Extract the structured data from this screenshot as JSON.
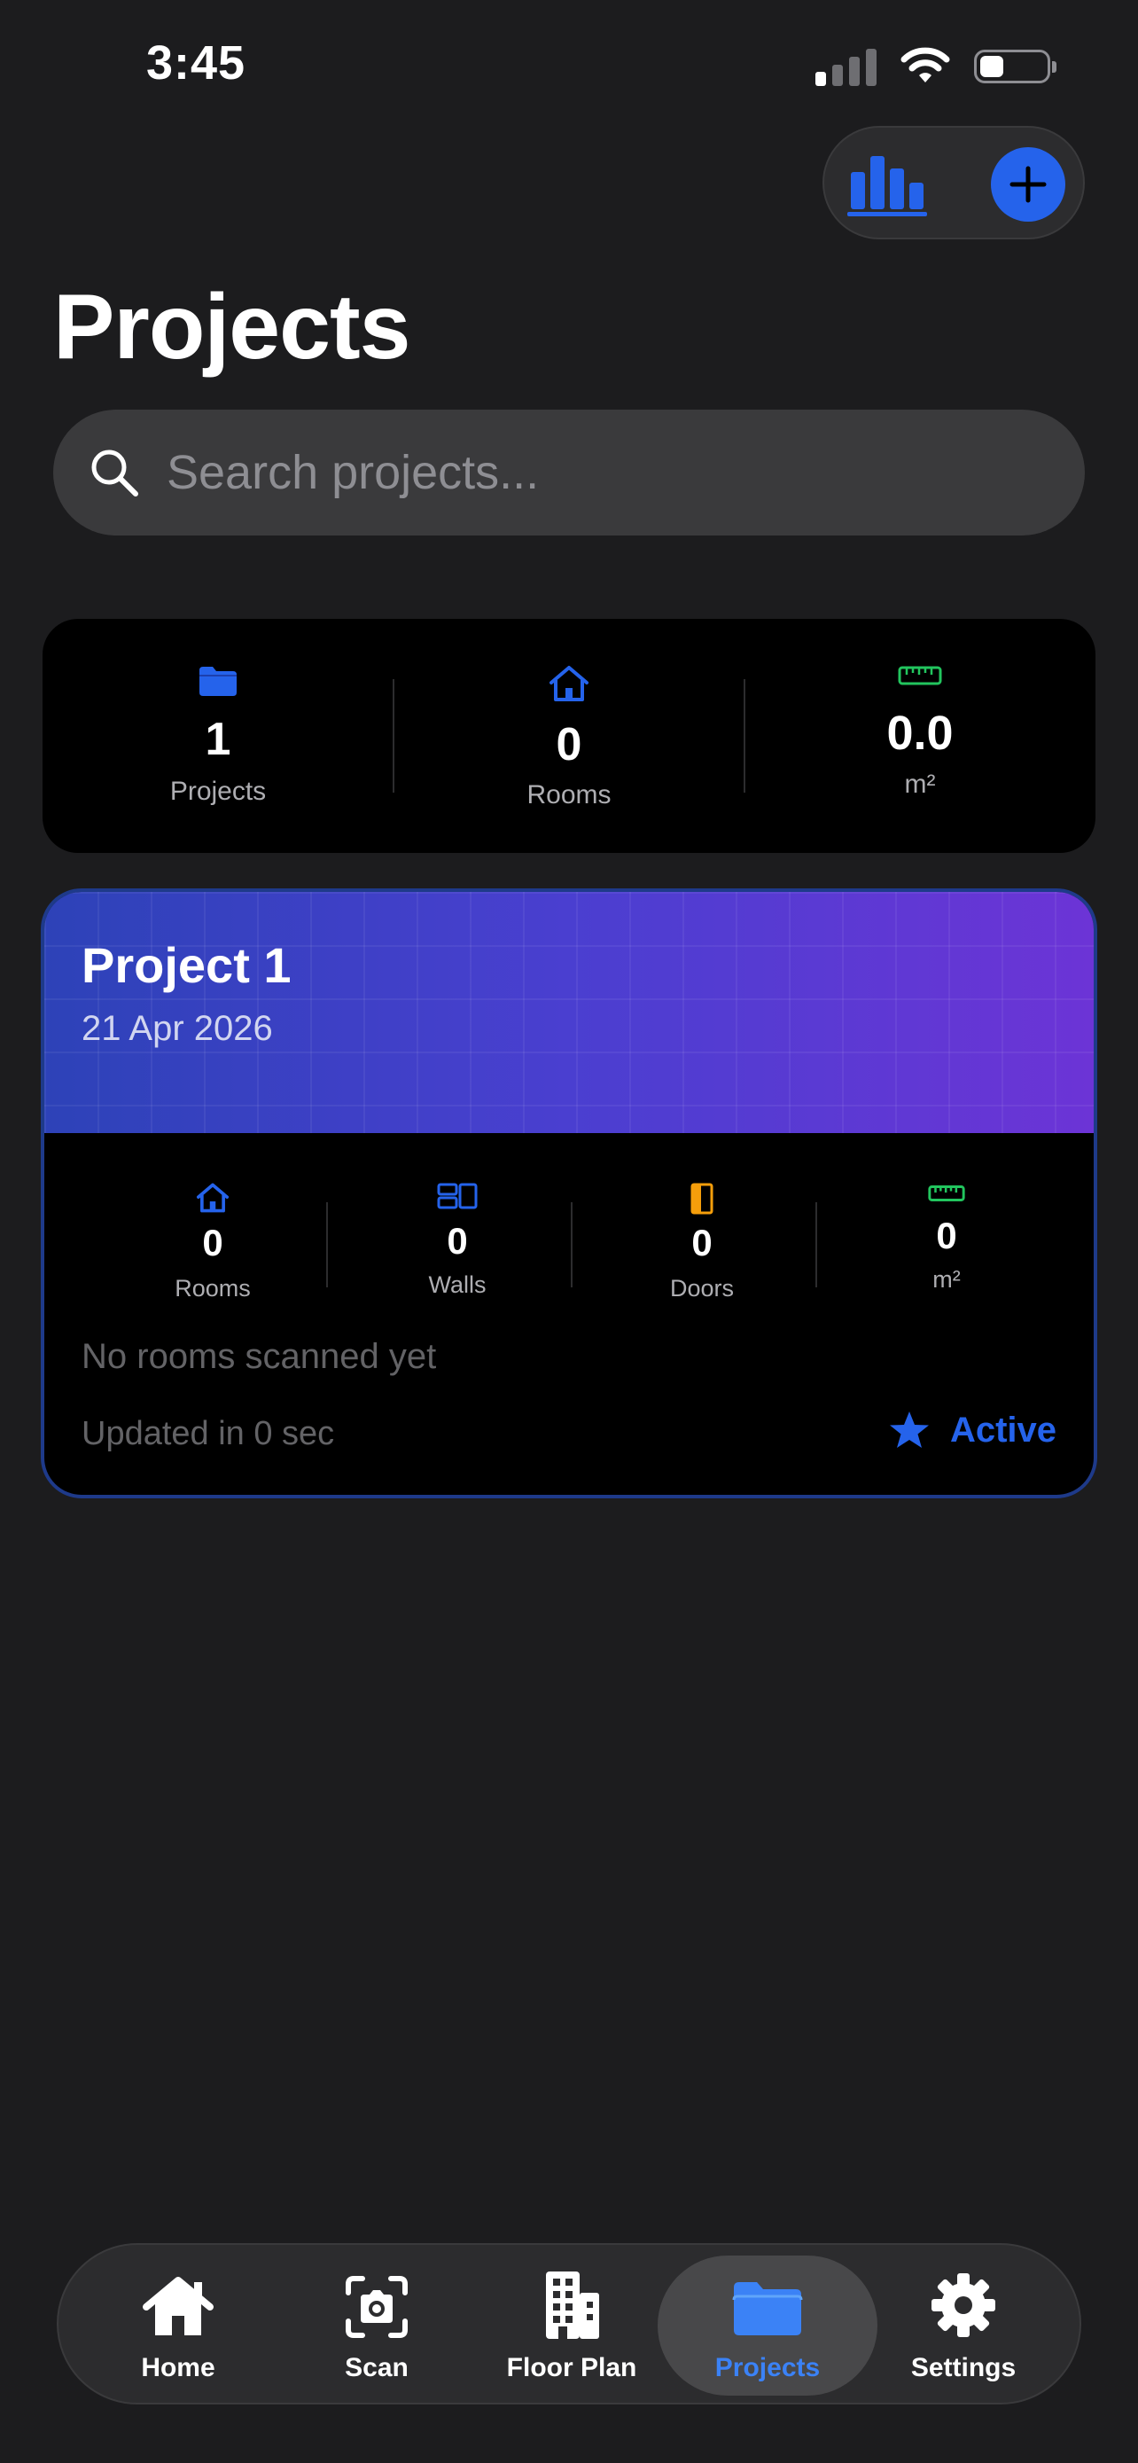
{
  "status_bar": {
    "time": "3:45"
  },
  "colors": {
    "accent": "#2563eb",
    "green": "#22c55e",
    "orange": "#f59e0b",
    "background": "#1c1c1e"
  },
  "header": {
    "title": "Projects"
  },
  "search": {
    "placeholder": "Search projects..."
  },
  "summary": [
    {
      "icon": "folder-icon",
      "value": "1",
      "label": "Projects"
    },
    {
      "icon": "house-icon",
      "value": "0",
      "label": "Rooms"
    },
    {
      "icon": "ruler-icon",
      "value": "0.0",
      "label": "m²"
    }
  ],
  "project": {
    "name": "Project 1",
    "date": "21 Apr 2026",
    "stats": [
      {
        "icon": "house-icon",
        "value": "0",
        "label": "Rooms"
      },
      {
        "icon": "walls-icon",
        "value": "0",
        "label": "Walls"
      },
      {
        "icon": "door-icon",
        "value": "0",
        "label": "Doors"
      },
      {
        "icon": "ruler-icon",
        "value": "0",
        "label": "m²"
      }
    ],
    "empty_message": "No rooms scanned yet",
    "updated": "Updated in 0 sec",
    "status": "Active"
  },
  "tabs": [
    {
      "label": "Home",
      "icon": "house-icon"
    },
    {
      "label": "Scan",
      "icon": "camera-scan-icon"
    },
    {
      "label": "Floor Plan",
      "icon": "building-icon"
    },
    {
      "label": "Projects",
      "icon": "folder-icon",
      "selected": true
    },
    {
      "label": "Settings",
      "icon": "gear-icon"
    }
  ]
}
